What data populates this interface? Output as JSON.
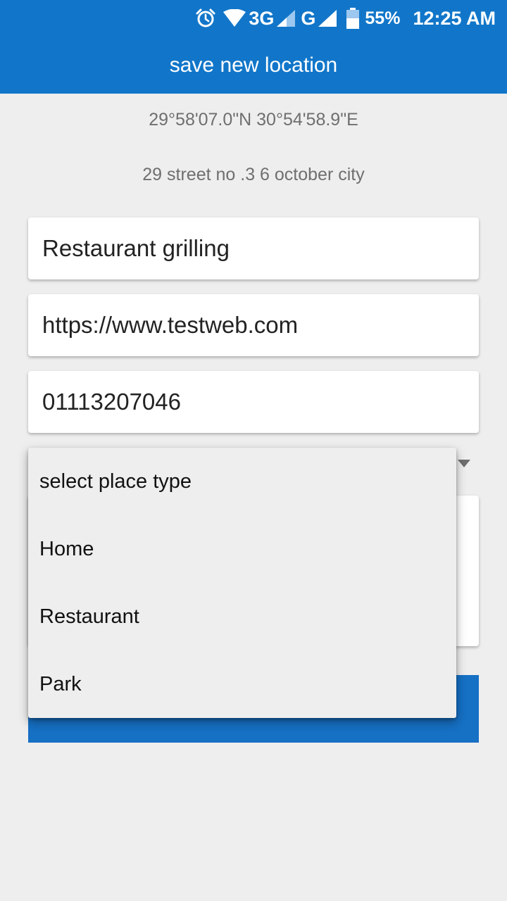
{
  "status_bar": {
    "network_3g": "3G",
    "network_g": "G",
    "battery": "55%",
    "time": "12:25 AM",
    "icons": [
      "alarm-icon",
      "wifi-icon",
      "signal-icon",
      "signal-icon",
      "battery-icon"
    ]
  },
  "app_bar": {
    "title": "save new location"
  },
  "location": {
    "coordinates": "29°58'07.0\"N 30°54'58.9\"E",
    "address": "29 street no .3 6 october city"
  },
  "form": {
    "name_value": "Restaurant grilling",
    "website_value": "https://www.testweb.com",
    "phone_value": "01113207046"
  },
  "place_type_dropdown": {
    "options": [
      "select place type",
      "Home",
      "Restaurant",
      "Park"
    ]
  },
  "colors": {
    "primary": "#1176c9",
    "button": "#1670c4",
    "background": "#eeeeee"
  }
}
